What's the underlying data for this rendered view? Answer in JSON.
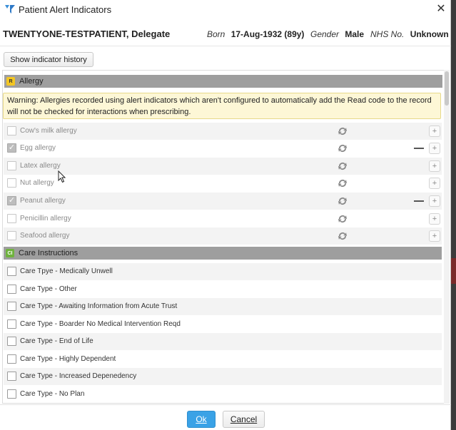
{
  "window": {
    "title": "Patient Alert Indicators",
    "close_glyph": "✕",
    "app_icon": "funnel-logo-icon"
  },
  "patient": {
    "name": "TWENTYONE-TESTPATIENT, Delegate",
    "born_label": "Born",
    "born_value": "17-Aug-1932 (89y)",
    "gender_label": "Gender",
    "gender_value": "Male",
    "nhs_label": "NHS No.",
    "nhs_value": "Unknown"
  },
  "toolbar": {
    "history_label": "Show indicator history"
  },
  "sections": [
    {
      "badge": "R",
      "badge_color": "#f3c623",
      "title": "Allergy",
      "warning": "Warning: Allergies recorded using alert indicators which aren't configured to automatically add the Read code to the record will not be checked for interactions when prescribing.",
      "items": [
        {
          "label": "Cow's milk allergy",
          "checked": false
        },
        {
          "label": "Egg allergy",
          "checked": true
        },
        {
          "label": "Latex allergy",
          "checked": false
        },
        {
          "label": "Nut allergy",
          "checked": false
        },
        {
          "label": "Peanut allergy",
          "checked": true
        },
        {
          "label": "Penicillin allergy",
          "checked": false
        },
        {
          "label": "Seafood allergy",
          "checked": false
        }
      ]
    },
    {
      "badge": "CI",
      "badge_color": "#6fb23e",
      "title": "Care Instructions",
      "items": [
        {
          "label": "Care Tpye - Medically Unwell",
          "checked": false
        },
        {
          "label": "Care Type -  Other",
          "checked": false
        },
        {
          "label": "Care Type - Awaiting Information from Acute Trust",
          "checked": false
        },
        {
          "label": "Care Type - Boarder No Medical Intervention Reqd",
          "checked": false
        },
        {
          "label": "Care Type - End of Life",
          "checked": false
        },
        {
          "label": "Care Type - Highly Dependent",
          "checked": false
        },
        {
          "label": "Care Type - Increased Depenedency",
          "checked": false
        },
        {
          "label": "Care Type - No Plan",
          "checked": false
        }
      ]
    }
  ],
  "icons": {
    "sync": "sync-icon",
    "add": "+",
    "remove": "minus-icon"
  },
  "footer": {
    "ok_label": "Ok",
    "cancel_label": "Cancel"
  }
}
